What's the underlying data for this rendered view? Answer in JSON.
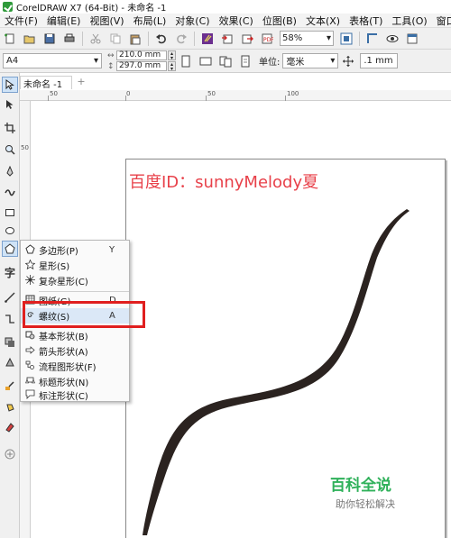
{
  "window": {
    "title": "CorelDRAW X7 (64-Bit) - 未命名 -1"
  },
  "menu": [
    "文件(F)",
    "编辑(E)",
    "视图(V)",
    "布局(L)",
    "对象(C)",
    "效果(C)",
    "位图(B)",
    "文本(X)",
    "表格(T)",
    "工具(O)",
    "窗口(W)"
  ],
  "toolbar": {
    "zoom_value": "58%"
  },
  "propbar": {
    "paper": "A4",
    "width": "210.0 mm",
    "height": "297.0 mm",
    "unit_label": "单位:",
    "unit_value": "毫米",
    "nudge_value": ".1 mm"
  },
  "doc": {
    "tab_label": "未命名 -1"
  },
  "rulers": {
    "h_labels": [
      "50",
      "0",
      "50",
      "100"
    ],
    "v_labels": [
      "50"
    ]
  },
  "flyout": {
    "items": [
      {
        "label": "多边形(P)",
        "key": "Y",
        "icon": "polygon-icon"
      },
      {
        "label": "星形(S)",
        "key": "",
        "icon": "star-icon"
      },
      {
        "label": "复杂星形(C)",
        "key": "",
        "icon": "complex-star-icon"
      },
      {
        "label": "图纸(G)",
        "key": "D",
        "icon": "graph-paper-icon"
      },
      {
        "label": "螺纹(S)",
        "key": "A",
        "icon": "spiral-icon"
      },
      {
        "label": "基本形状(B)",
        "key": "",
        "icon": "basic-shapes-icon"
      },
      {
        "label": "箭头形状(A)",
        "key": "",
        "icon": "arrow-shapes-icon"
      },
      {
        "label": "流程图形状(F)",
        "key": "",
        "icon": "flowchart-shapes-icon"
      },
      {
        "label": "标题形状(N)",
        "key": "",
        "icon": "banner-shapes-icon"
      },
      {
        "label": "标注形状(C)",
        "key": "",
        "icon": "callout-shapes-icon"
      }
    ]
  },
  "overlay": {
    "watermark": "百度ID：sunnyMelody夏",
    "brand": "百科全说",
    "brand_sub": "助你轻松解决"
  }
}
